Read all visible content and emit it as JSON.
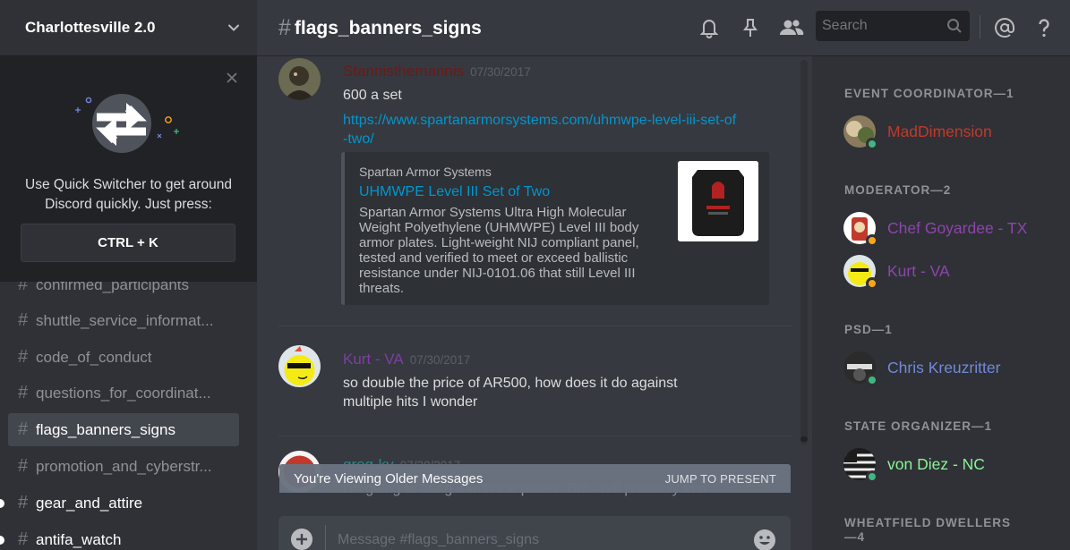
{
  "server": {
    "name": "Charlottesville 2.0"
  },
  "quick_switcher": {
    "text": "Use Quick Switcher to get around Discord quickly. Just press:",
    "shortcut": "CTRL + K"
  },
  "channels": [
    {
      "name": "confirmed_participants",
      "state": "normal"
    },
    {
      "name": "shuttle_service_informat...",
      "state": "normal"
    },
    {
      "name": "code_of_conduct",
      "state": "normal"
    },
    {
      "name": "questions_for_coordinat...",
      "state": "normal"
    },
    {
      "name": "flags_banners_signs",
      "state": "active"
    },
    {
      "name": "promotion_and_cyberstr...",
      "state": "normal"
    },
    {
      "name": "gear_and_attire",
      "state": "unread"
    },
    {
      "name": "antifa_watch",
      "state": "unread"
    }
  ],
  "chat": {
    "channel": "flags_banners_signs",
    "search_placeholder": "Search",
    "composer_placeholder": "Message #flags_banners_signs",
    "older_bar": {
      "text": "You're Viewing Older Messages",
      "action": "JUMP TO PRESENT"
    }
  },
  "messages": [
    {
      "author": "Stannisthemannis",
      "author_color": "#6b1a1a",
      "timestamp": "07/30/2017",
      "text": "600 a set",
      "link": "https://www.spartanarmorsystems.com/uhmwpe-level-iii-set-of-two/",
      "embed": {
        "provider": "Spartan Armor Systems",
        "title": "UHMWPE Level III Set of Two",
        "description": "Spartan Armor Systems Ultra High Molecular Weight Polyethylene (UHMWPE) Level III body armor plates. Light-weight NIJ compliant panel, tested and verified to meet or exceed ballistic resistance under NIJ-0101.06 that still Level III threats."
      }
    },
    {
      "author": "Kurt - VA",
      "author_color": "#7d3fa3",
      "timestamp": "07/30/2017",
      "text": "so double the price of AR500, how does it do against multiple hits I wonder"
    },
    {
      "author": "greg-ky",
      "author_color": "#1f8b8b",
      "timestamp": "07/30/2017",
      "text": "I'm going to bring it with the plates. But I will probably end"
    }
  ],
  "members": {
    "groups": [
      {
        "role": "EVENT COORDINATOR—1",
        "members": [
          {
            "name": "MadDimension",
            "color": "#c1392b",
            "status": "online"
          }
        ]
      },
      {
        "role": "MODERATOR—2",
        "members": [
          {
            "name": "Chef Goyardee - TX",
            "color": "#8e44ad",
            "status": "idle"
          },
          {
            "name": "Kurt - VA",
            "color": "#8e44ad",
            "status": "idle"
          }
        ]
      },
      {
        "role": "PSD—1",
        "members": [
          {
            "name": "Chris Kreuzritter",
            "color": "#7289da",
            "status": "online"
          }
        ]
      },
      {
        "role": "STATE ORGANIZER—1",
        "members": [
          {
            "name": "von Diez - NC",
            "color": "#8af595",
            "status": "online"
          }
        ]
      },
      {
        "role": "WHEATFIELD DWELLERS—4",
        "members": []
      }
    ]
  },
  "colors": {
    "online": "#43b581",
    "idle": "#faa61a",
    "link": "#0096cf",
    "background": "#36393f",
    "sidebar": "#2f3136"
  }
}
